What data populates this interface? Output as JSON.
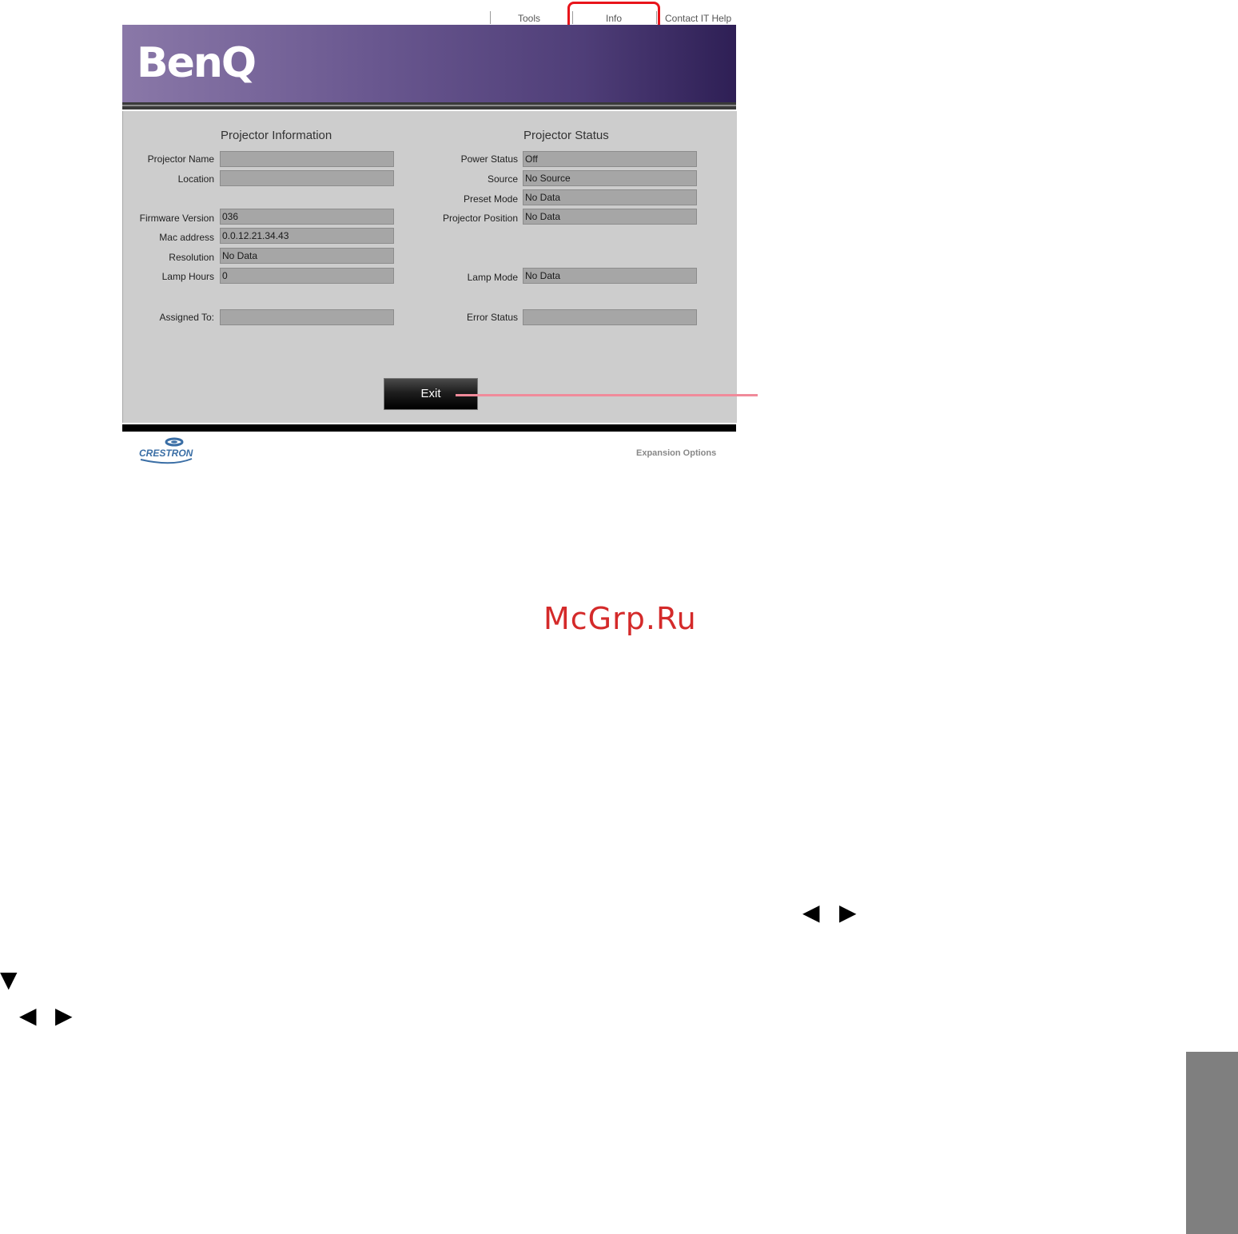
{
  "nav": {
    "tools": "Tools",
    "info": "Info",
    "contact": "Contact IT Help"
  },
  "banner": {
    "logo": "BenQ"
  },
  "info_section": {
    "title": "Projector Information",
    "fields": [
      {
        "label": "Projector Name",
        "value": ""
      },
      {
        "label": "Location",
        "value": ""
      },
      {
        "label": "Firmware Version",
        "value": "036"
      },
      {
        "label": "Mac address",
        "value": "0.0.12.21.34.43"
      },
      {
        "label": "Resolution",
        "value": "No Data"
      },
      {
        "label": "Lamp Hours",
        "value": "0"
      },
      {
        "label": "Assigned To:",
        "value": ""
      }
    ]
  },
  "status_section": {
    "title": "Projector Status",
    "fields": [
      {
        "label": "Power Status",
        "value": "Off"
      },
      {
        "label": "Source",
        "value": "No Source"
      },
      {
        "label": "Preset Mode",
        "value": "No Data"
      },
      {
        "label": "Projector Position",
        "value": "No Data"
      },
      {
        "label": "Lamp Mode",
        "value": "No Data"
      },
      {
        "label": "Error Status",
        "value": ""
      }
    ]
  },
  "exit_label": "Exit",
  "footer": {
    "logo": "CRESTRON",
    "expansion": "Expansion Options"
  },
  "watermark": "McGrp.Ru",
  "arrows": {
    "left": "◀",
    "right": "▶",
    "down": "▼"
  },
  "colors": {
    "highlight": "#e8141b",
    "callout": "#f08a9a",
    "panel": "#cdcdcd",
    "field": "#a6a6a6",
    "watermark": "#d42a2a"
  }
}
